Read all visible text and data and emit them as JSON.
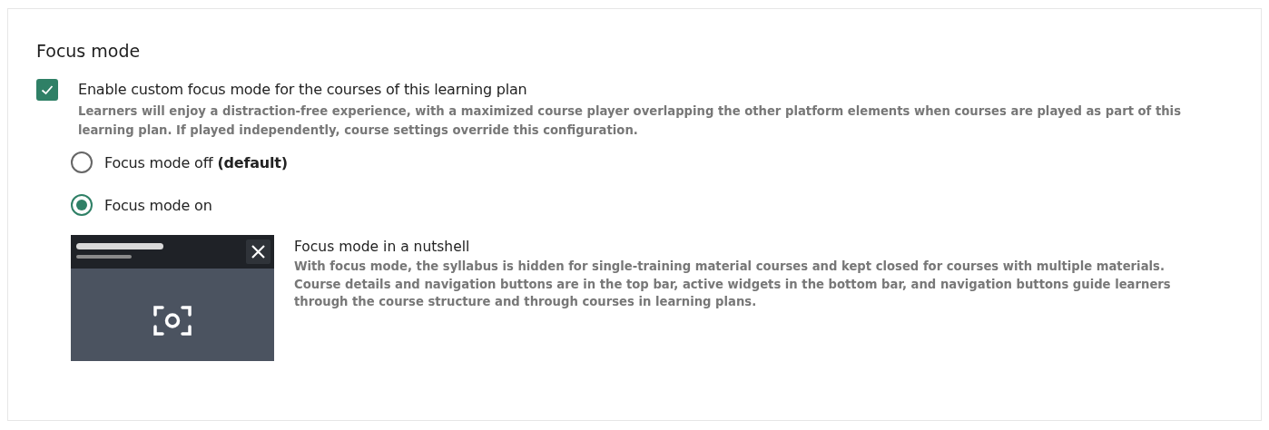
{
  "section": {
    "title": "Focus mode",
    "enable": {
      "label": "Enable custom focus mode for the courses of this learning plan",
      "checked": true,
      "description": "Learners will enjoy a distraction-free experience, with a maximized course player overlapping the other platform elements when courses are played as part of this learning plan. If played independently, course settings override this configuration."
    },
    "options": [
      {
        "label": "Focus mode off **(default)**",
        "selected": false
      },
      {
        "label": "Focus mode on",
        "selected": true
      }
    ],
    "info": {
      "title": "Focus mode in a nutshell",
      "text": "With focus mode, the syllabus is hidden for single-training material courses and kept closed for courses with multiple materials. Course details and navigation buttons are in the top bar, active widgets in the bottom bar, and navigation buttons guide learners through the course structure and through courses in learning plans."
    }
  }
}
